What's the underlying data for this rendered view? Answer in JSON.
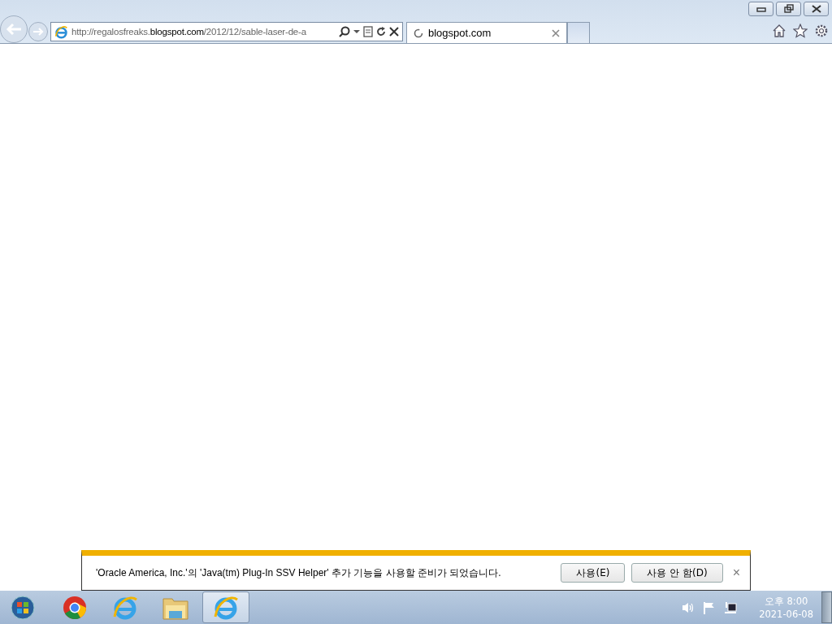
{
  "browser": {
    "address": "http://regalosfreaks.**blogspot.com**/2012/12/sable-laser-de-a",
    "tabs": [
      {
        "label": "blogspot.com",
        "selected": true,
        "loading": true
      }
    ]
  },
  "notification": {
    "message": "'Oracle America, Inc.'의 'Java(tm) Plug-In SSV Helper' 추가 기능을 사용할 준비가 되었습니다.",
    "buttons": [
      "사용(E)",
      "사용 안 함(D)"
    ],
    "close": "×"
  },
  "taskbar": {
    "items": [
      {
        "kind": "chrome",
        "selected": false
      },
      {
        "kind": "ie",
        "selected": false
      },
      {
        "kind": "folder",
        "selected": false
      },
      {
        "kind": "ie",
        "selected": true
      }
    ],
    "clock": {
      "time": "오후 8:00",
      "date": "2021-06-08"
    }
  }
}
